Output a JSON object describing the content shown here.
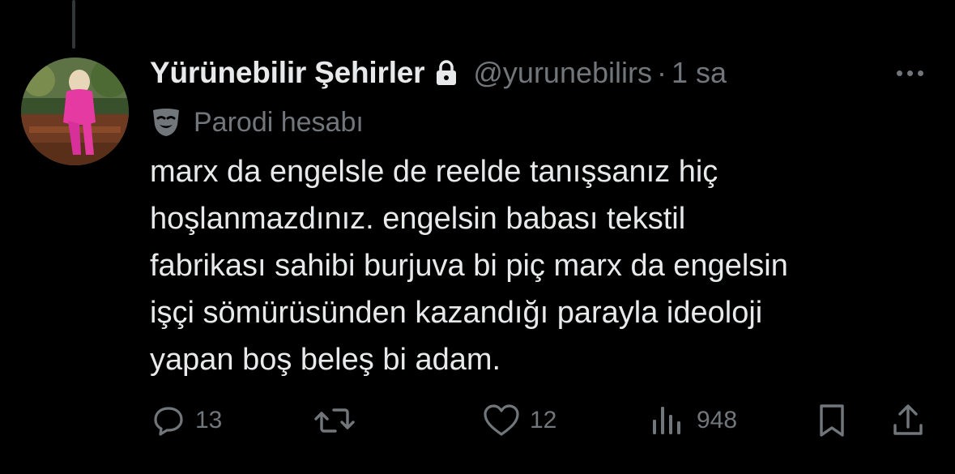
{
  "author": {
    "display_name": "Yürünebilir Şehirler",
    "handle": "@yurunebilirs",
    "separator": "·",
    "time": "1 sa",
    "label": "Parodi hesabı",
    "avatar_icon": "avatar-photo",
    "lock_icon": "lock-icon",
    "label_icon": "theater-mask-icon"
  },
  "tweet": {
    "lines": [
      "marx da engelsle de reelde tanışsanız hiç",
      "hoşlanmazdınız. engelsin babası tekstil",
      "fabrikası sahibi burjuva bi piç marx da engelsin",
      "işçi sömürüsünden kazandığı parayla ideoloji",
      "yapan boş beleş bi adam."
    ]
  },
  "actions": {
    "reply_count": "13",
    "repost_count": "",
    "like_count": "12",
    "views_count": "948"
  },
  "colors": {
    "background": "#000000",
    "text_primary": "#e7e9ea",
    "text_secondary": "#71767b"
  }
}
